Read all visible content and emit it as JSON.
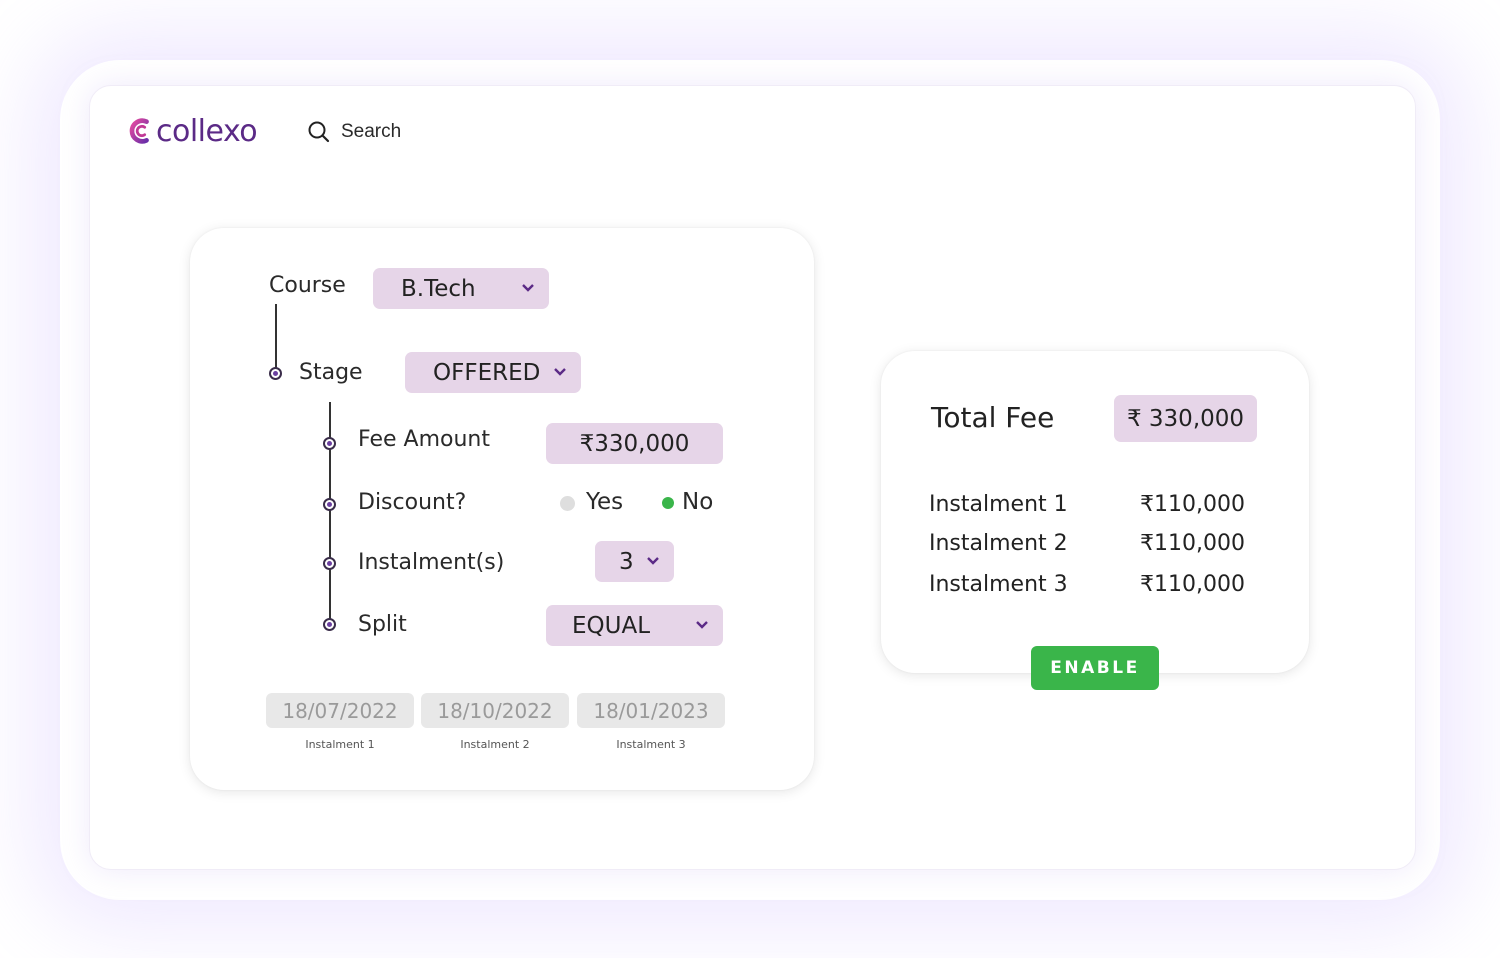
{
  "header": {
    "logo_text": "collexo",
    "search_label": "Search"
  },
  "form": {
    "course_label": "Course",
    "course_value": "B.Tech",
    "stage_label": "Stage",
    "stage_value": "OFFERED",
    "fee_label": "Fee Amount",
    "fee_value": "₹330,000",
    "discount_label": "Discount?",
    "discount_yes": "Yes",
    "discount_no": "No",
    "discount_selected": "No",
    "instalments_label": "Instalment(s)",
    "instalments_value": "3",
    "split_label": "Split",
    "split_value": "EQUAL"
  },
  "dates": [
    {
      "date": "18/07/2022",
      "caption": "Instalment 1"
    },
    {
      "date": "18/10/2022",
      "caption": "Instalment 2"
    },
    {
      "date": "18/01/2023",
      "caption": "Instalment 3"
    }
  ],
  "summary": {
    "total_label": "Total Fee",
    "total_value": "₹ 330,000",
    "instalments": [
      {
        "label": "Instalment 1",
        "amount": "₹110,000"
      },
      {
        "label": "Instalment 2",
        "amount": "₹110,000"
      },
      {
        "label": "Instalment 3",
        "amount": "₹110,000"
      }
    ],
    "enable_label": "ENABLE"
  },
  "colors": {
    "brand": "#5b2a86",
    "pill": "#e6d5e8",
    "accent_green": "#3ab54a"
  }
}
